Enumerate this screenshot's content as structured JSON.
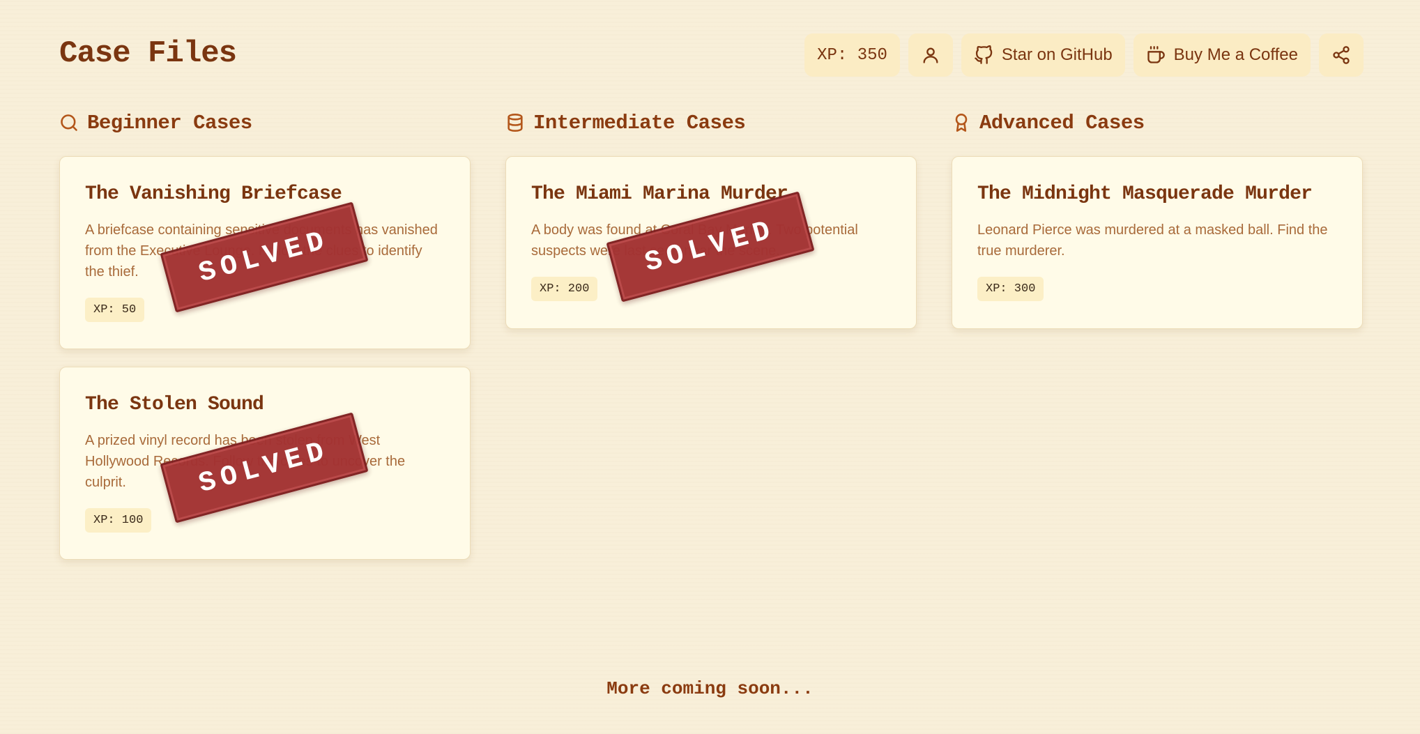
{
  "page": {
    "title": "Case Files"
  },
  "toolbar": {
    "xp_label": "XP: 350",
    "profile_icon": "user-icon",
    "github_label": "Star on GitHub",
    "github_icon": "github-icon",
    "coffee_label": "Buy Me a Coffee",
    "coffee_icon": "coffee-cup-icon",
    "share_icon": "share-icon"
  },
  "columns": [
    {
      "title": "Beginner Cases",
      "icon": "search-icon",
      "cases": [
        {
          "title": "The Vanishing Briefcase",
          "description": "A briefcase containing sensitive documents has vanished from the Executive Lounge. Follow the clues to identify the thief.",
          "xp": "XP: 50",
          "stamp": "SOLVED"
        },
        {
          "title": "The Stolen Sound",
          "description": "A prized vinyl record has been stolen from West Hollywood Records. Follow the clues to uncover the culprit.",
          "xp": "XP: 100",
          "stamp": "SOLVED"
        }
      ]
    },
    {
      "title": "Intermediate Cases",
      "icon": "database-icon",
      "cases": [
        {
          "title": "The Miami Marina Murder",
          "description": "A body was found at Coral Bay Marina. Two potential suspects were last seen near the scene.",
          "xp": "XP: 200",
          "stamp": "SOLVED"
        }
      ]
    },
    {
      "title": "Advanced Cases",
      "icon": "award-icon",
      "cases": [
        {
          "title": "The Midnight Masquerade Murder",
          "description": "Leonard Pierce was murdered at a masked ball. Find the true murderer.",
          "xp": "XP: 300",
          "stamp": ""
        }
      ]
    }
  ],
  "footer": {
    "note": "More coming soon..."
  },
  "colors": {
    "background": "#f8efd9",
    "card": "#fffbe8",
    "heading": "#7a3510",
    "accent": "#b3561a",
    "stamp": "#a33232",
    "badge": "#fcefc6"
  }
}
